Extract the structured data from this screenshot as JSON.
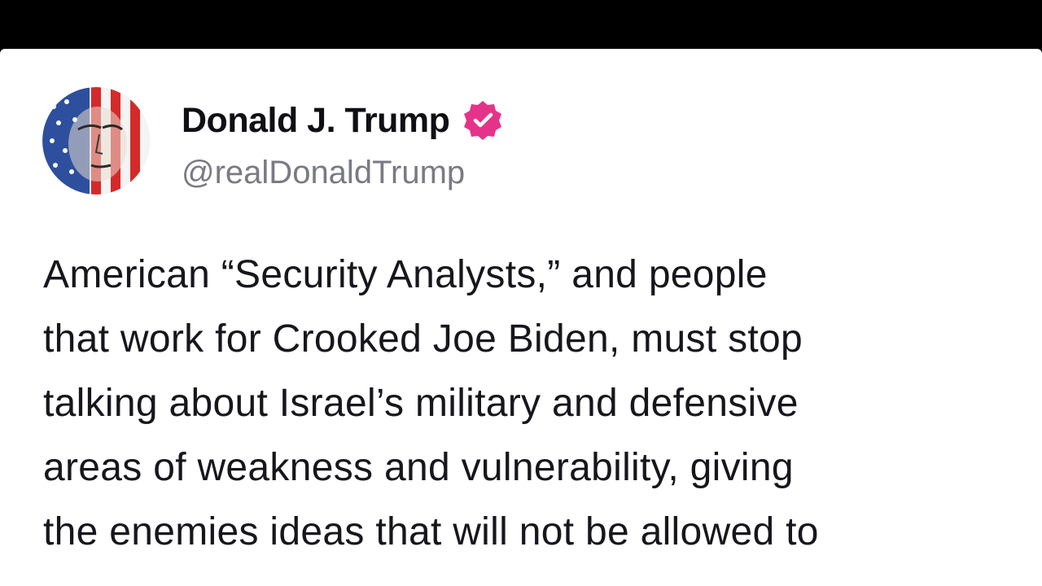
{
  "author": {
    "display_name": "Donald J. Trump",
    "handle": "@realDonaldTrump",
    "verified": true,
    "avatar": "flag-portrait-avatar",
    "verified_badge_color": "#e5338a"
  },
  "post": {
    "lines": [
      "American “Security Analysts,” and people",
      "that work for Crooked Joe Biden, must stop",
      "talking about Israel’s military and defensive",
      "areas of weakness and vulnerability, giving",
      "the enemies ideas that will not be allowed to"
    ]
  },
  "colors": {
    "background": "#000000",
    "card": "#ffffff",
    "text": "#16161d",
    "handle": "#7a7a84"
  }
}
